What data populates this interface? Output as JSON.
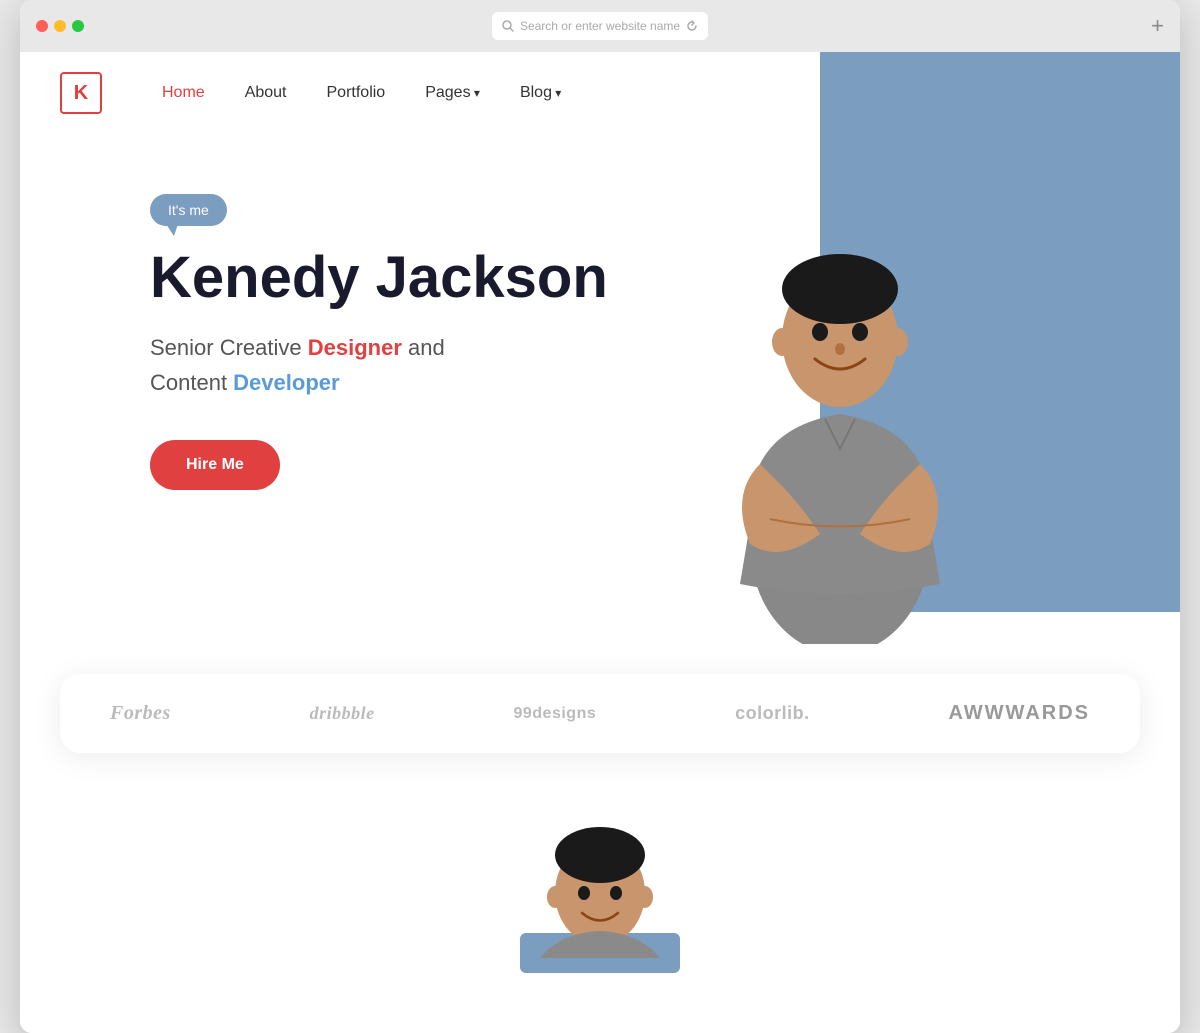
{
  "browser": {
    "url_placeholder": "Search or enter website name",
    "new_tab_label": "+"
  },
  "navbar": {
    "logo_letter": "K",
    "links": [
      {
        "id": "home",
        "label": "Home",
        "active": true,
        "has_dropdown": false
      },
      {
        "id": "about",
        "label": "About",
        "active": false,
        "has_dropdown": false
      },
      {
        "id": "portfolio",
        "label": "Portfolio",
        "active": false,
        "has_dropdown": false
      },
      {
        "id": "pages",
        "label": "Pages",
        "active": false,
        "has_dropdown": true
      },
      {
        "id": "blog",
        "label": "Blog",
        "active": false,
        "has_dropdown": true
      }
    ]
  },
  "hero": {
    "bubble_text": "It's me",
    "name": "Kenedy Jackson",
    "subtitle_start": "Senior Creative ",
    "designer_word": "Designer",
    "subtitle_mid": " and",
    "subtitle_line2": "Content ",
    "developer_word": "Developer",
    "hire_button": "Hire Me"
  },
  "brands": [
    {
      "id": "forbes",
      "label": "Forbes",
      "style": "forbes"
    },
    {
      "id": "dribbble",
      "label": "dribbble",
      "style": "dribbble"
    },
    {
      "id": "99designs",
      "label": "99designs",
      "style": "designs"
    },
    {
      "id": "colorlib",
      "label": "colorlib.",
      "style": "colorlib"
    },
    {
      "id": "awwwards",
      "label": "AWWWARDS",
      "style": "awwwards"
    }
  ],
  "colors": {
    "accent_red": "#e04040",
    "accent_blue": "#7b9dbf",
    "text_blue": "#5b9bd5",
    "dark": "#1a1a2e"
  }
}
